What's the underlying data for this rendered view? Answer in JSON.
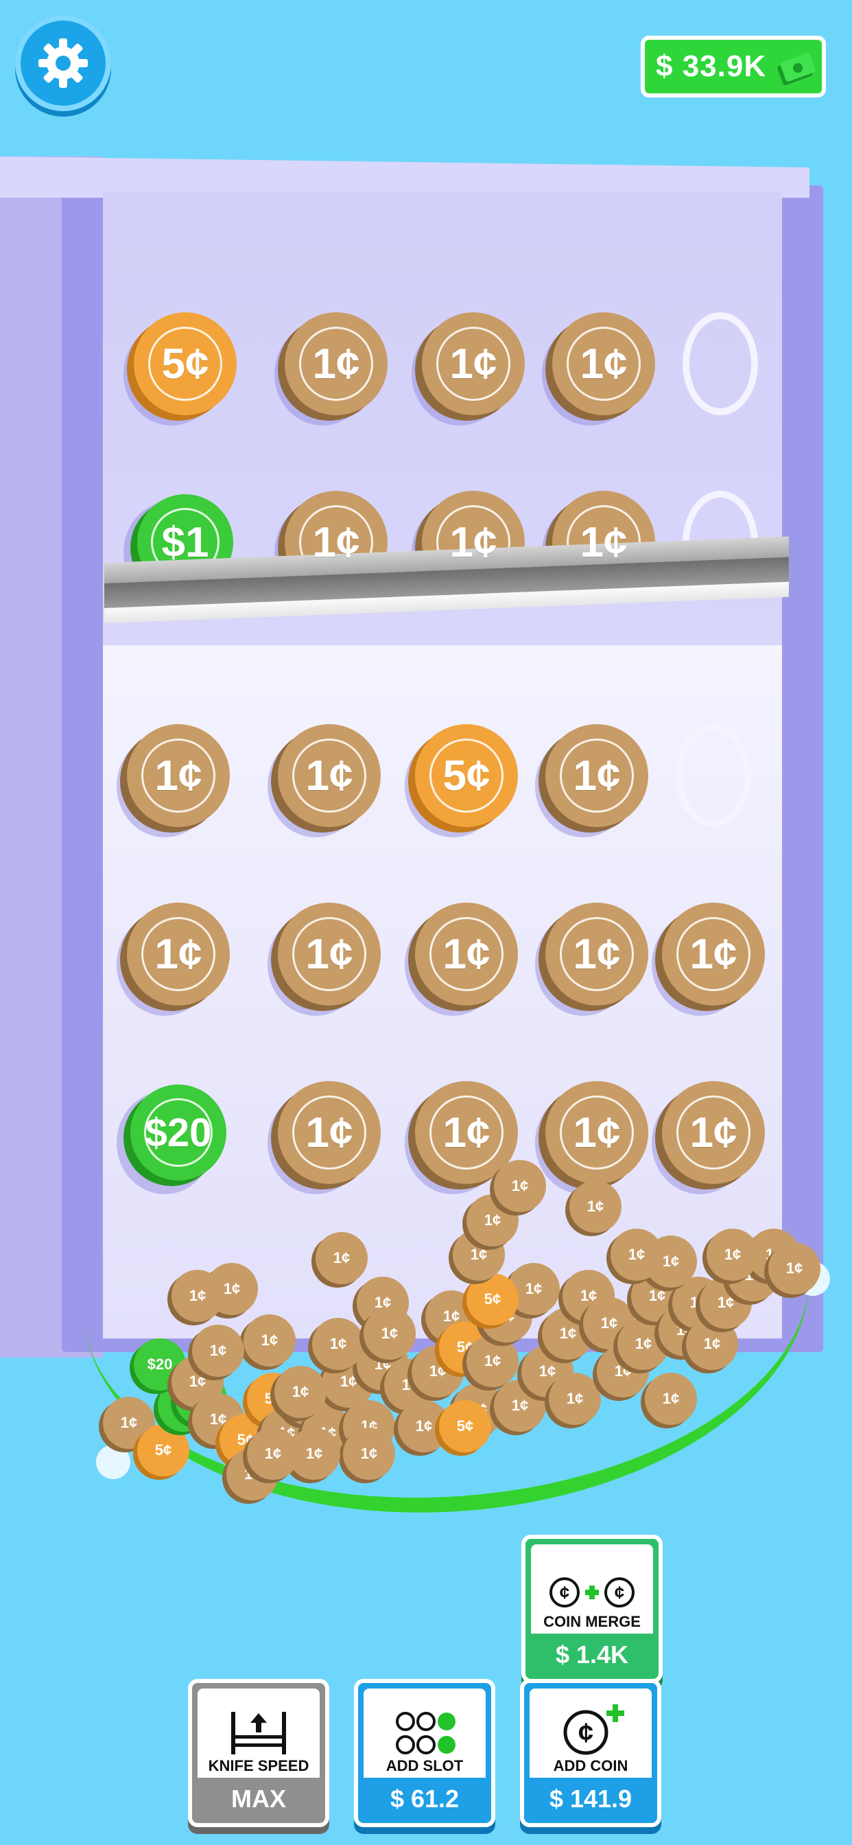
{
  "hud": {
    "settings_icon": "gear-icon",
    "money": "$ 33.9K",
    "money_icon": "cash-stack-icon"
  },
  "board": {
    "upper_rows": [
      [
        "5¢",
        "1¢",
        "1¢",
        "1¢",
        ""
      ],
      [
        "$1",
        "1¢",
        "1¢",
        "1¢",
        ""
      ]
    ],
    "lower_rows": [
      [
        "1¢",
        "1¢",
        "5¢",
        "1¢",
        ""
      ],
      [
        "1¢",
        "1¢",
        "1¢",
        "1¢",
        "1¢"
      ],
      [
        "$20",
        "1¢",
        "1¢",
        "1¢",
        "1¢"
      ]
    ]
  },
  "pile": {
    "coin_labels": [
      "1¢",
      "5¢",
      "$1",
      "$20"
    ]
  },
  "upgrades": {
    "coin_merge": {
      "label": "COIN MERGE",
      "price": "$ 1.4K",
      "icon": "coin-merge-icon"
    },
    "knife_speed": {
      "label": "KNIFE SPEED",
      "price": "MAX",
      "icon": "knife-speed-icon"
    },
    "add_slot": {
      "label": "ADD SLOT",
      "price": "$ 61.2",
      "icon": "slot-dots-icon"
    },
    "add_coin": {
      "label": "ADD COIN",
      "price": "$ 141.9",
      "icon": "add-coin-icon"
    }
  },
  "colors": {
    "background": "#6fd6fb",
    "cash_green": "#2fd63a",
    "button_blue": "#1e9fe6",
    "button_gray": "#8f8f8f",
    "button_green": "#2fbf6a",
    "copper": "#c89c66",
    "gold": "#f2a43a",
    "dollar_green": "#3ccb3a"
  }
}
